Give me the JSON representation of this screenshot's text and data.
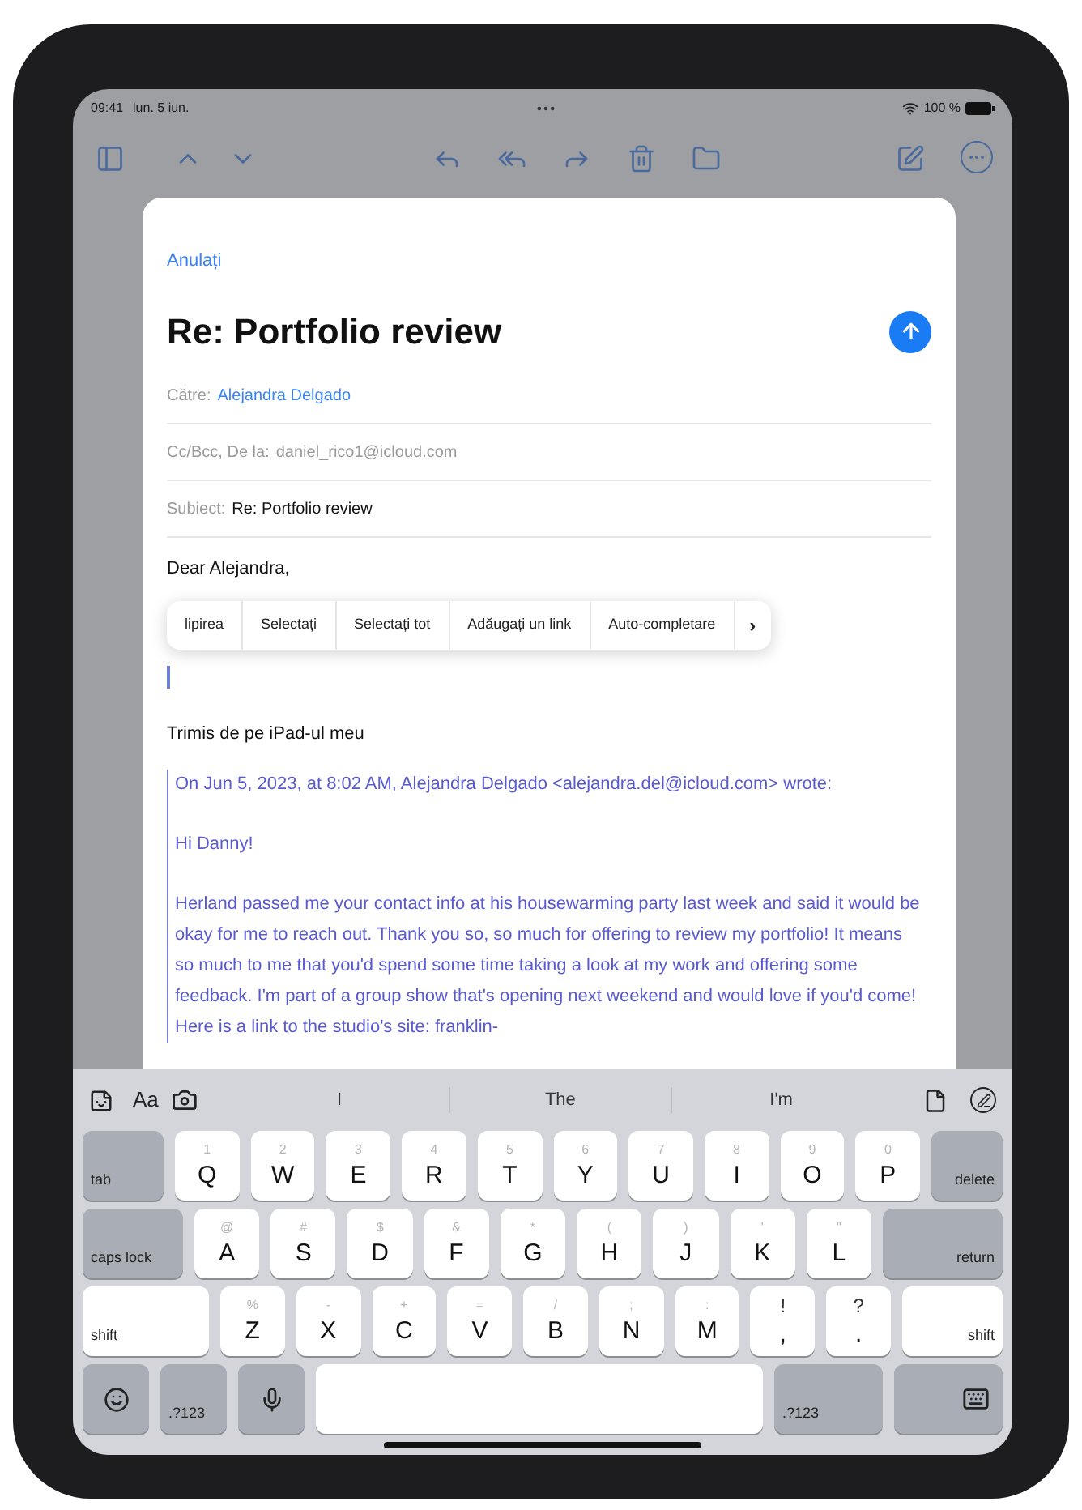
{
  "status_bar": {
    "time": "09:41",
    "date": "lun. 5 iun.",
    "battery": "100 %"
  },
  "compose": {
    "cancel": "Anulați",
    "title": "Re: Portfolio review",
    "fields": [
      {
        "kind": "recipient",
        "label": "Către:",
        "value": "Alejandra Delgado"
      },
      {
        "kind": "plain",
        "label": "Cc/Bcc, De la:",
        "value": "daniel_rico1@icloud.com"
      },
      {
        "kind": "subject",
        "label": "Subiect:",
        "value": "Re: Portfolio review"
      }
    ],
    "greeting": "Dear Alejandra,",
    "edit_menu": [
      "lipirea",
      "Selectați",
      "Selectați tot",
      "Adăugați un link",
      "Auto-completare"
    ],
    "menu_more": "›",
    "signature": "Trimis de pe iPad-ul meu",
    "quote": {
      "header": "On Jun 5, 2023, at 8:02 AM, Alejandra Delgado <alejandra.del@icloud.com> wrote:",
      "paragraphs": [
        "Hi Danny!",
        "Herland passed me your contact info at his housewarming party last week and said it would be okay for me to reach out. Thank you so, so much for offering to review my portfolio! It means so much to me that you'd spend some time taking a look at my work and offering some feedback. I'm part of a group show that's opening next weekend and would love if you'd come! Here is a link to the studio's site: franklin-"
      ]
    }
  },
  "keyboard": {
    "format_label": "Aa",
    "suggestions": [
      "I",
      "The",
      "I'm"
    ],
    "rows": [
      [
        {
          "kind": "tab",
          "label": "tab"
        },
        {
          "kind": "letter",
          "label": "Q",
          "hint": "1"
        },
        {
          "kind": "letter",
          "label": "W",
          "hint": "2"
        },
        {
          "kind": "letter",
          "label": "E",
          "hint": "3"
        },
        {
          "kind": "letter",
          "label": "R",
          "hint": "4"
        },
        {
          "kind": "letter",
          "label": "T",
          "hint": "5"
        },
        {
          "kind": "letter",
          "label": "Y",
          "hint": "6"
        },
        {
          "kind": "letter",
          "label": "U",
          "hint": "7"
        },
        {
          "kind": "letter",
          "label": "I",
          "hint": "8"
        },
        {
          "kind": "letter",
          "label": "O",
          "hint": "9"
        },
        {
          "kind": "letter",
          "label": "P",
          "hint": "0"
        },
        {
          "kind": "delete",
          "label": "delete"
        }
      ],
      [
        {
          "kind": "caps",
          "label": "caps lock"
        },
        {
          "kind": "letter",
          "label": "A",
          "hint": "@"
        },
        {
          "kind": "letter",
          "label": "S",
          "hint": "#"
        },
        {
          "kind": "letter",
          "label": "D",
          "hint": "$"
        },
        {
          "kind": "letter",
          "label": "F",
          "hint": "&"
        },
        {
          "kind": "letter",
          "label": "G",
          "hint": "*"
        },
        {
          "kind": "letter",
          "label": "H",
          "hint": "("
        },
        {
          "kind": "letter",
          "label": "J",
          "hint": ")"
        },
        {
          "kind": "letter",
          "label": "K",
          "hint": "'"
        },
        {
          "kind": "letter",
          "label": "L",
          "hint": "\""
        },
        {
          "kind": "return",
          "label": "return"
        }
      ],
      [
        {
          "kind": "shift",
          "label": "shift"
        },
        {
          "kind": "letter",
          "label": "Z",
          "hint": "%"
        },
        {
          "kind": "letter",
          "label": "X",
          "hint": "-"
        },
        {
          "kind": "letter",
          "label": "C",
          "hint": "+"
        },
        {
          "kind": "letter",
          "label": "V",
          "hint": "="
        },
        {
          "kind": "letter",
          "label": "B",
          "hint": "/"
        },
        {
          "kind": "letter",
          "label": "N",
          "hint": ";"
        },
        {
          "kind": "letter",
          "label": "M",
          "hint": ":"
        },
        {
          "kind": "punct",
          "label": ",",
          "hint": "!"
        },
        {
          "kind": "punct",
          "label": ".",
          "hint": "?"
        },
        {
          "kind": "shift_right",
          "label": "shift"
        }
      ],
      [
        {
          "kind": "emoji"
        },
        {
          "kind": "numbers",
          "label": ".?123"
        },
        {
          "kind": "dictation"
        },
        {
          "kind": "space"
        },
        {
          "kind": "numbers_wide",
          "label": ".?123"
        },
        {
          "kind": "hide"
        }
      ]
    ]
  }
}
